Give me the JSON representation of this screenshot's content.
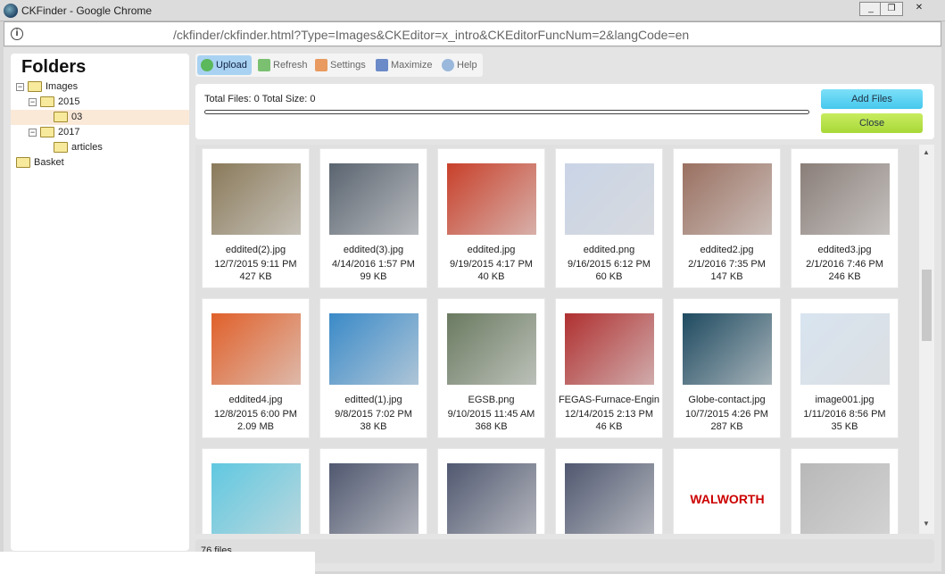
{
  "window": {
    "title": "CKFinder - Google Chrome",
    "url": "/ckfinder/ckfinder.html?Type=Images&CKEditor=x_intro&CKEditorFuncNum=2&langCode=en"
  },
  "folders": {
    "title": "Folders",
    "nodes": [
      {
        "label": "Images",
        "level": 0,
        "toggle": "−"
      },
      {
        "label": "2015",
        "level": 1,
        "toggle": "−"
      },
      {
        "label": "03",
        "level": 2,
        "toggle": "",
        "selected": true
      },
      {
        "label": "2017",
        "level": 1,
        "toggle": "−"
      },
      {
        "label": "articles",
        "level": 2,
        "toggle": ""
      },
      {
        "label": "Basket",
        "level": 0,
        "toggle": ""
      }
    ]
  },
  "toolbar": {
    "upload": "Upload",
    "refresh": "Refresh",
    "settings": "Settings",
    "maximize": "Maximize",
    "help": "Help"
  },
  "upload": {
    "totals": "Total Files: 0 Total Size: 0",
    "progress": 0,
    "add_files": "Add Files",
    "close": "Close"
  },
  "files": [
    {
      "name": "eddited(2).jpg",
      "date": "12/7/2015 9:11 PM",
      "size": "427 KB",
      "color": "#8a7a5a"
    },
    {
      "name": "eddited(3).jpg",
      "date": "4/14/2016 1:57 PM",
      "size": "99 KB",
      "color": "#5a6470"
    },
    {
      "name": "eddited.jpg",
      "date": "9/19/2015 4:17 PM",
      "size": "40 KB",
      "color": "#c8402a"
    },
    {
      "name": "eddited.png",
      "date": "9/16/2015 6:12 PM",
      "size": "60 KB",
      "color": "#c9d4e6"
    },
    {
      "name": "eddited2.jpg",
      "date": "2/1/2016 7:35 PM",
      "size": "147 KB",
      "color": "#9a7060"
    },
    {
      "name": "eddited3.jpg",
      "date": "2/1/2016 7:46 PM",
      "size": "246 KB",
      "color": "#8a7e78"
    },
    {
      "name": "eddited4.jpg",
      "date": "12/8/2015 6:00 PM",
      "size": "2.09 MB",
      "color": "#e0602a"
    },
    {
      "name": "editted(1).jpg",
      "date": "9/8/2015 7:02 PM",
      "size": "38 KB",
      "color": "#3a8ac8"
    },
    {
      "name": "EGSB.png",
      "date": "9/10/2015 11:45 AM",
      "size": "368 KB",
      "color": "#6a7a60"
    },
    {
      "name": "FEGAS-Furnace-Engin",
      "date": "12/14/2015 2:13 PM",
      "size": "46 KB",
      "color": "#b03030"
    },
    {
      "name": "Globe-contact.jpg",
      "date": "10/7/2015 4:26 PM",
      "size": "287 KB",
      "color": "#1e4a60"
    },
    {
      "name": "image001.jpg",
      "date": "1/11/2016 8:56 PM",
      "size": "35 KB",
      "color": "#d8e4f0"
    },
    {
      "name": "",
      "date": "",
      "size": "",
      "color": "#60c8e0"
    },
    {
      "name": "",
      "date": "",
      "size": "",
      "color": "#505870"
    },
    {
      "name": "",
      "date": "",
      "size": "",
      "color": "#505870"
    },
    {
      "name": "",
      "date": "",
      "size": "",
      "color": "#505870"
    },
    {
      "name": "",
      "date": "",
      "size": "",
      "color": "#ffffff",
      "logo": "WALWORTH"
    },
    {
      "name": "",
      "date": "",
      "size": "",
      "color": "#b8b8b8"
    }
  ],
  "status": {
    "count": "76 files"
  }
}
